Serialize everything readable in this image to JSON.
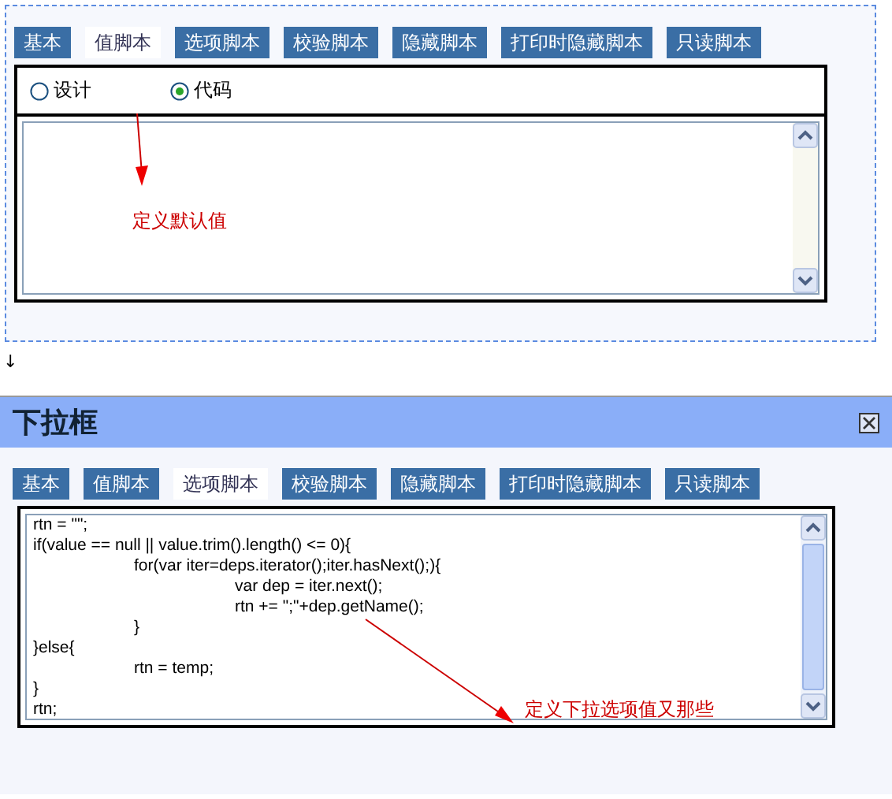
{
  "designer": {
    "tabs": [
      {
        "label": "基本",
        "selected": false
      },
      {
        "label": "值脚本",
        "selected": true
      },
      {
        "label": "选项脚本",
        "selected": false
      },
      {
        "label": "校验脚本",
        "selected": false
      },
      {
        "label": "隐藏脚本",
        "selected": false
      },
      {
        "label": "打印时隐藏脚本",
        "selected": false
      },
      {
        "label": "只读脚本",
        "selected": false
      }
    ],
    "radios": [
      {
        "label": "设计",
        "selected": false
      },
      {
        "label": "代码",
        "selected": true
      }
    ],
    "annotation": "定义默认值"
  },
  "separator_glyph": "↓",
  "dialog": {
    "title": "下拉框",
    "tabs": [
      {
        "label": "基本",
        "selected": false
      },
      {
        "label": "值脚本",
        "selected": false
      },
      {
        "label": "选项脚本",
        "selected": true
      },
      {
        "label": "校验脚本",
        "selected": false
      },
      {
        "label": "隐藏脚本",
        "selected": false
      },
      {
        "label": "打印时隐藏脚本",
        "selected": false
      },
      {
        "label": "只读脚本",
        "selected": false
      }
    ],
    "code_lines": [
      "rtn = \"\";",
      "if(value == null || value.trim().length() <= 0){",
      "\tfor(var iter=deps.iterator();iter.hasNext();){",
      "\t\tvar dep = iter.next();",
      "\t\trtn += \";\"+dep.getName();",
      "\t}",
      "}else{",
      "\trtn = temp;",
      "}",
      "rtn;"
    ],
    "annotation": "定义下拉选项值又那些"
  }
}
